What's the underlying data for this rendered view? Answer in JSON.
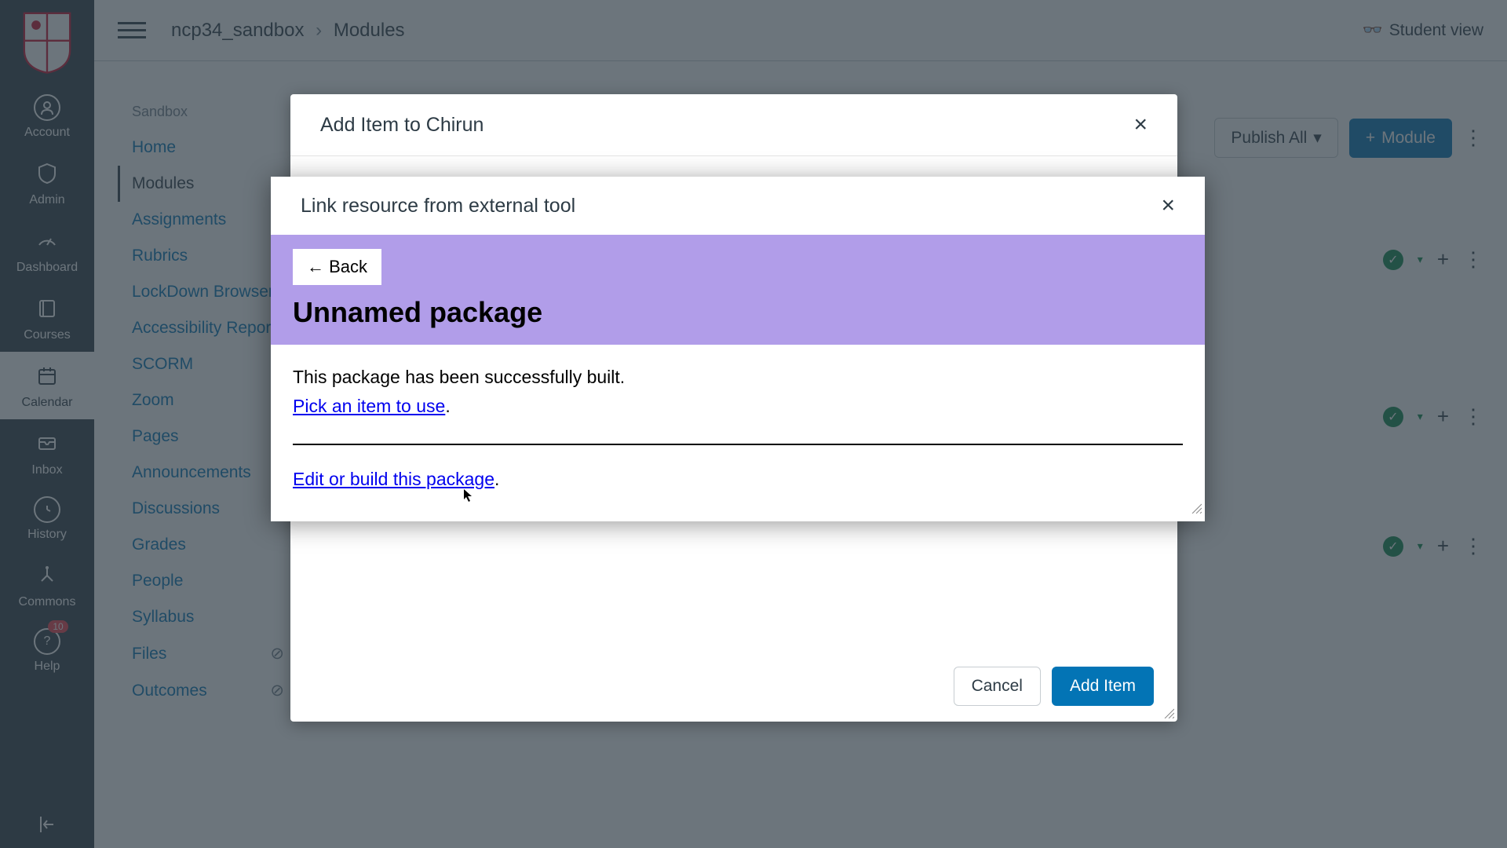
{
  "globalNav": {
    "account": "Account",
    "admin": "Admin",
    "dashboard": "Dashboard",
    "courses": "Courses",
    "calendar": "Calendar",
    "inbox": "Inbox",
    "history": "History",
    "commons": "Commons",
    "help": "Help",
    "helpBadge": "10"
  },
  "header": {
    "courseCode": "ncp34_sandbox",
    "pageName": "Modules",
    "studentView": "Student view"
  },
  "courseNav": {
    "title": "Sandbox",
    "items": [
      "Home",
      "Modules",
      "Assignments",
      "Rubrics",
      "LockDown Browser",
      "Accessibility Report",
      "SCORM",
      "Zoom",
      "Pages",
      "Announcements",
      "Discussions",
      "Grades",
      "People",
      "Syllabus",
      "Files",
      "Outcomes"
    ]
  },
  "toolbar": {
    "publishAll": "Publish All",
    "module": "Module"
  },
  "modal1": {
    "title": "Add Item to Chirun",
    "cancel": "Cancel",
    "addItem": "Add Item"
  },
  "modal2": {
    "title": "Link resource from external tool",
    "back": "← Back",
    "packageTitle": "Unnamed package",
    "successMsg": "This package has been successfully built.",
    "pickLink": "Pick an item to use",
    "editLink": "Edit or build this package"
  }
}
